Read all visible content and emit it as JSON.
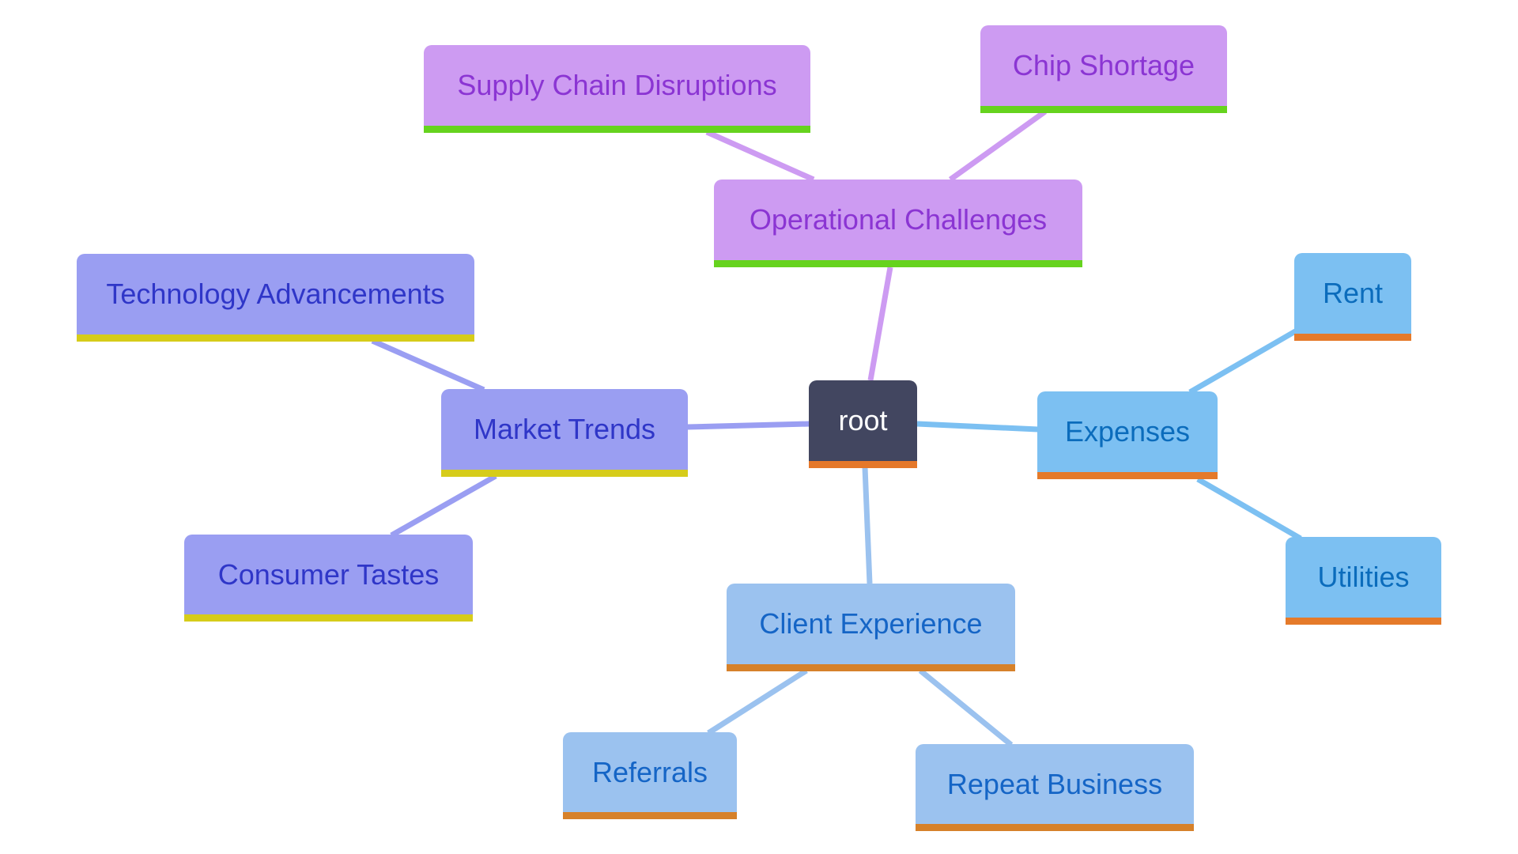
{
  "diagram": {
    "type": "mindmap",
    "root": {
      "id": "root",
      "label": "root"
    },
    "branches": [
      {
        "id": "operational",
        "label": "Operational Challenges",
        "theme": "purple",
        "children": [
          {
            "id": "supply",
            "label": "Supply Chain Disruptions"
          },
          {
            "id": "chip",
            "label": "Chip Shortage"
          }
        ]
      },
      {
        "id": "market",
        "label": "Market Trends",
        "theme": "indigo",
        "children": [
          {
            "id": "tech",
            "label": "Technology Advancements"
          },
          {
            "id": "consumer",
            "label": "Consumer Tastes"
          }
        ]
      },
      {
        "id": "expenses",
        "label": "Expenses",
        "theme": "sky",
        "children": [
          {
            "id": "rent",
            "label": "Rent"
          },
          {
            "id": "utilities",
            "label": "Utilities"
          }
        ]
      },
      {
        "id": "client",
        "label": "Client Experience",
        "theme": "lightblue",
        "children": [
          {
            "id": "referrals",
            "label": "Referrals"
          },
          {
            "id": "repeat",
            "label": "Repeat Business"
          }
        ]
      }
    ],
    "themes": {
      "root": {
        "fill": "#424660",
        "text": "#ffffff",
        "bar": "#e5782a",
        "edge": "#424660"
      },
      "purple": {
        "fill": "#cd9bf2",
        "text": "#8b35d3",
        "bar": "#66d31e",
        "edge": "#cd9bf2"
      },
      "indigo": {
        "fill": "#9a9ef2",
        "text": "#2f36c8",
        "bar": "#d6cc1a",
        "edge": "#9a9ef2"
      },
      "sky": {
        "fill": "#7cc0f2",
        "text": "#0b6cbc",
        "bar": "#e57a2a",
        "edge": "#7cc0f2"
      },
      "lightblue": {
        "fill": "#9bc2ef",
        "text": "#1565c6",
        "bar": "#d6812a",
        "edge": "#9bc2ef"
      }
    }
  }
}
